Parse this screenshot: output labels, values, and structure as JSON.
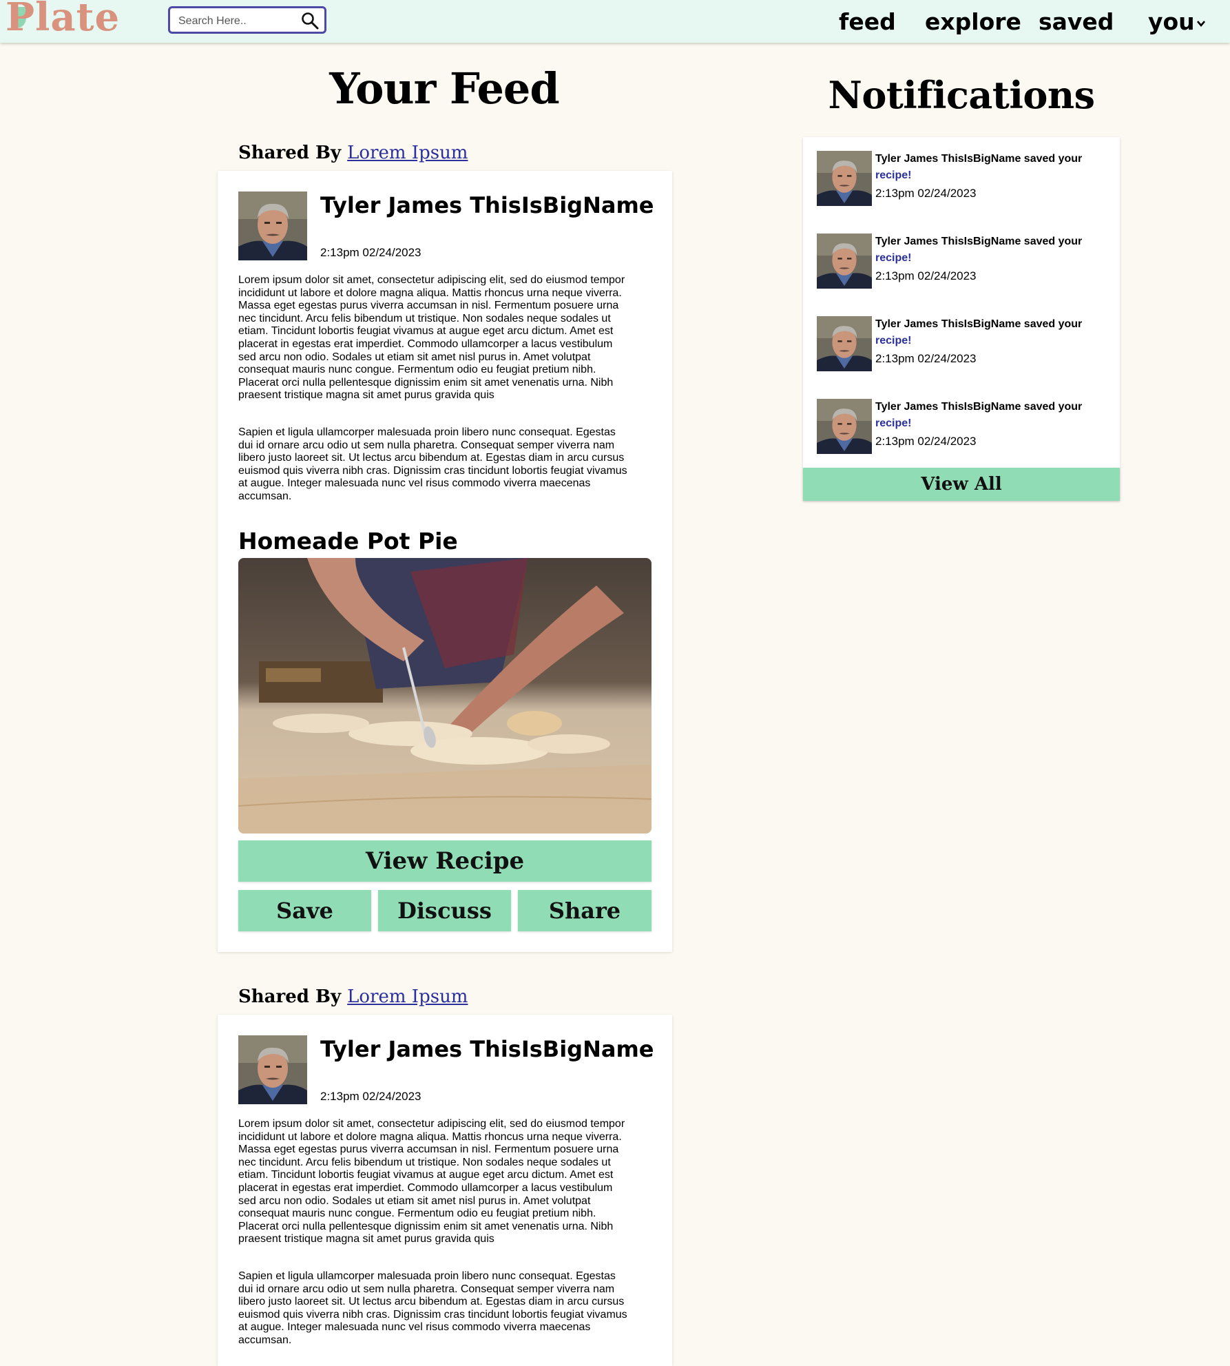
{
  "nav": {
    "logo": "Plate",
    "search_placeholder": "Search Here..",
    "links": [
      "feed",
      "explore",
      "saved",
      "you"
    ]
  },
  "feed": {
    "title": "Your Feed",
    "posts": [
      {
        "shared_by_prefix": "Shared By",
        "shared_by_name": "Lorem Ipsum",
        "author": "Tyler James ThisIsBigName",
        "time": "2:13pm 02/24/2023",
        "para1": "Lorem ipsum dolor sit amet, consectetur adipiscing elit, sed do eiusmod tempor incididunt ut labore et dolore magna aliqua. Mattis rhoncus urna neque viverra. Massa eget egestas purus viverra accumsan in nisl. Fermentum posuere urna nec tincidunt. Arcu felis bibendum ut tristique. Non sodales neque sodales ut etiam. Tincidunt lobortis feugiat vivamus at augue eget arcu dictum. Amet est placerat in egestas erat imperdiet. Commodo ullamcorper a lacus vestibulum sed arcu non odio. Sodales ut etiam sit amet nisl purus in. Amet volutpat consequat mauris nunc congue. Fermentum odio eu feugiat pretium nibh. Placerat orci nulla pellentesque dignissim enim sit amet venenatis urna. Nibh praesent tristique magna sit amet purus gravida quis",
        "para2": "Sapien et ligula ullamcorper malesuada proin libero nunc consequat. Egestas dui id ornare arcu odio ut sem nulla pharetra. Consequat semper viverra nam libero justo laoreet sit. Ut lectus arcu bibendum at. Egestas diam in arcu cursus euismod quis viverra nibh cras. Dignissim cras tincidunt lobortis feugiat vivamus at augue. Integer malesuada nunc vel risus commodo viverra maecenas accumsan.",
        "recipe_title": "Homeade Pot Pie",
        "view_recipe": "View Recipe",
        "save": "Save",
        "discuss": "Discuss",
        "share": "Share"
      },
      {
        "shared_by_prefix": "Shared By",
        "shared_by_name": "Lorem Ipsum",
        "author": "Tyler James ThisIsBigName",
        "time": "2:13pm 02/24/2023",
        "para1": "Lorem ipsum dolor sit amet, consectetur adipiscing elit, sed do eiusmod tempor incididunt ut labore et dolore magna aliqua. Mattis rhoncus urna neque viverra. Massa eget egestas purus viverra accumsan in nisl. Fermentum posuere urna nec tincidunt. Arcu felis bibendum ut tristique. Non sodales neque sodales ut etiam. Tincidunt lobortis feugiat vivamus at augue eget arcu dictum. Amet est placerat in egestas erat imperdiet. Commodo ullamcorper a lacus vestibulum sed arcu non odio. Sodales ut etiam sit amet nisl purus in. Amet volutpat consequat mauris nunc congue. Fermentum odio eu feugiat pretium nibh. Placerat orci nulla pellentesque dignissim enim sit amet venenatis urna. Nibh praesent tristique magna sit amet purus gravida quis",
        "para2": "Sapien et ligula ullamcorper malesuada proin libero nunc consequat. Egestas dui id ornare arcu odio ut sem nulla pharetra. Consequat semper viverra nam libero justo laoreet sit. Ut lectus arcu bibendum at. Egestas diam in arcu cursus euismod quis viverra nibh cras. Dignissim cras tincidunt lobortis feugiat vivamus at augue. Integer malesuada nunc vel risus commodo viverra maecenas accumsan."
      }
    ]
  },
  "notifications": {
    "title": "Notifications",
    "items": [
      {
        "text": "Tyler James ThisIsBigName saved your",
        "link": "recipe!",
        "time": "2:13pm 02/24/2023"
      },
      {
        "text": "Tyler James ThisIsBigName saved your",
        "link": "recipe!",
        "time": "2:13pm 02/24/2023"
      },
      {
        "text": "Tyler James ThisIsBigName saved your",
        "link": "recipe!",
        "time": "2:13pm 02/24/2023"
      },
      {
        "text": "Tyler James ThisIsBigName saved your",
        "link": "recipe!",
        "time": "2:13pm 02/24/2023"
      }
    ],
    "view_all": "View All"
  },
  "colors": {
    "nav_bg": "#e6f8f1",
    "page_bg": "#fcf9f2",
    "accent_button": "#90dcb5",
    "link": "#2a2f9c",
    "logo": "#d9927e"
  },
  "icons": {
    "search": "search-icon",
    "dropdown": "chevron-down-icon",
    "avatar": "avatar",
    "recipe_photo": "recipe-photo"
  }
}
